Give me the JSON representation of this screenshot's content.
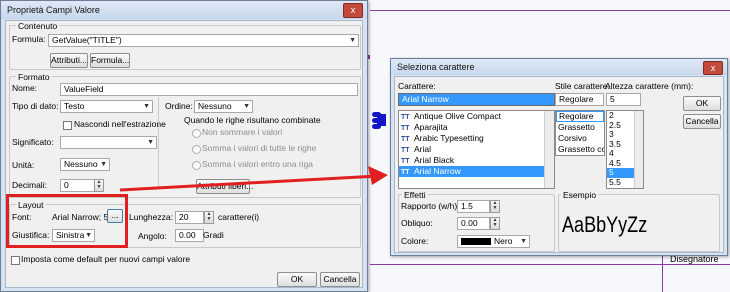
{
  "background": {
    "right_label": "Disegnatore"
  },
  "colors": {
    "accent_red": "#e02020",
    "selection_blue": "#3399ff"
  },
  "props": {
    "title": "Proprietà Campi Valore",
    "close_label": "x",
    "contenuto": {
      "legend": "Contenuto",
      "formula_label": "Formula:",
      "formula_value": "GetValue(\"TITLE\")",
      "btn_attributi": "Attributi...",
      "btn_formula": "Formula..."
    },
    "formato": {
      "legend": "Formato",
      "nome_label": "Nome:",
      "nome_value": "ValueField",
      "tipo_label": "Tipo di dato:",
      "tipo_value": "Testo",
      "nascondi_label": "Nascondi nell'estrazione",
      "significato_label": "Significato:",
      "significato_value": "",
      "unita_label": "Unità:",
      "unita_value": "Nessuno",
      "decimali_label": "Decimali:",
      "decimali_value": "0",
      "ordine_label": "Ordine:",
      "ordine_value": "Nessuno",
      "combine_label": "Quando le righe risultano combinate",
      "radio_non_sommare": "Non sommare i valori",
      "radio_somma_tutte": "Somma i valori di tutte le righe",
      "radio_somma_entro": "Somma i valori entro una riga",
      "btn_attributi_liberi": "Attributi liberi..."
    },
    "layout": {
      "legend": "Layout",
      "font_label": "Font:",
      "font_value": "Arial Narrow; 5",
      "font_btn": "...",
      "giustifica_label": "Giustifica:",
      "giustifica_value": "Sinistra",
      "lunghezza_label": "Lunghezza:",
      "lunghezza_value": "20",
      "lunghezza_unit": "carattere(i)",
      "angolo_label": "Angolo:",
      "angolo_value": "0.00",
      "angolo_unit": "Gradi"
    },
    "default_checkbox": "Imposta come default per nuovi campi valore",
    "ok": "OK",
    "cancel": "Cancella"
  },
  "fontdlg": {
    "title": "Seleziona carattere",
    "close_label": "x",
    "carattere_label": "Carattere:",
    "carattere_value": "Arial Narrow",
    "fonts": [
      "Antique Olive Compact",
      "Aparajita",
      "Arabic Typesetting",
      "Arial",
      "Arial Black",
      "Arial Narrow"
    ],
    "stile_label": "Stile carattere:",
    "stile_value": "Regolare",
    "stili": [
      "Regolare",
      "Grassetto",
      "Corsivo",
      "Grassetto cors"
    ],
    "altezza_label": "Altezza carattere (mm):",
    "altezza_value": "5",
    "altezze": [
      "2",
      "2.5",
      "3",
      "3.5",
      "4",
      "4.5",
      "5",
      "5.5"
    ],
    "ok": "OK",
    "cancel": "Cancella",
    "effetti": {
      "legend": "Effetti",
      "rapporto_label": "Rapporto (w/h):",
      "rapporto_value": "1.5",
      "obliquo_label": "Obliquo:",
      "obliquo_value": "0.00",
      "colore_label": "Colore:",
      "colore_value": "Nero"
    },
    "esempio": {
      "legend": "Esempio",
      "sample": "AaBbYyZz"
    }
  }
}
